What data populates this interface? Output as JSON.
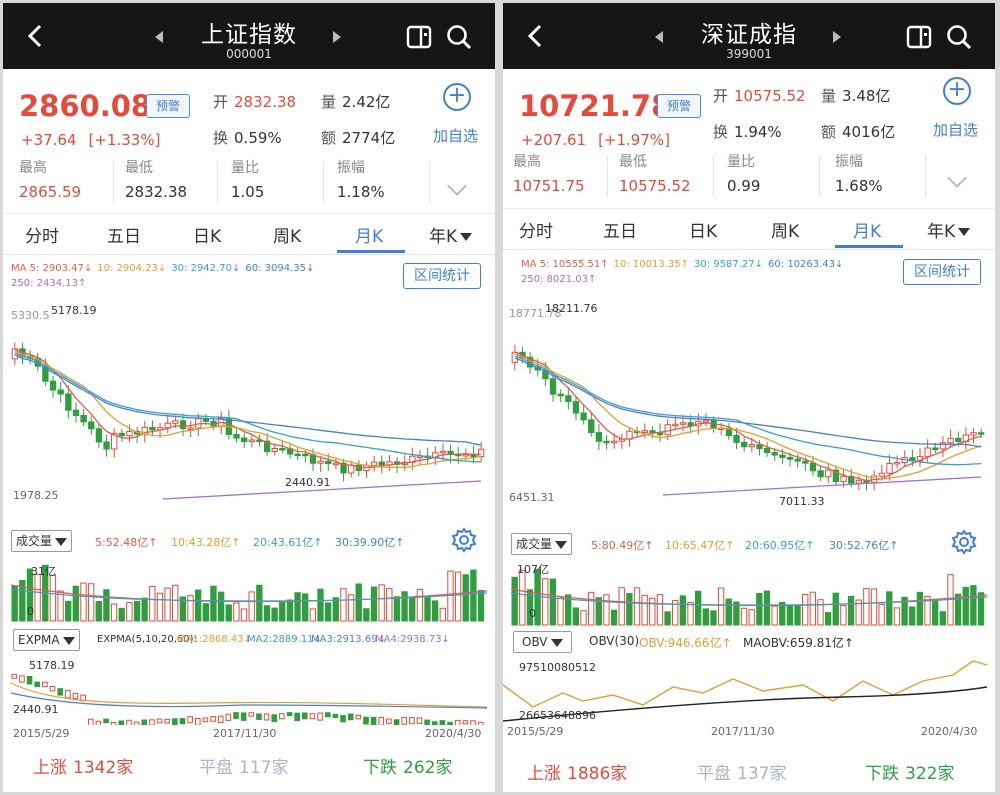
{
  "left": {
    "title": "上证指数",
    "code": "000001",
    "price": "2860.08",
    "warn_label": "预警",
    "change": "+37.64",
    "change_pct": "[+1.33%]",
    "open_label": "开",
    "open": "2832.38",
    "volume_label": "量",
    "volume": "2.42亿",
    "turnover_label": "换",
    "turnover": "0.59%",
    "amount_label": "额",
    "amount": "2774亿",
    "add_watch": "加自选",
    "high_label": "最高",
    "high": "2865.59",
    "low_label": "最低",
    "low": "2832.38",
    "ratio_label": "量比",
    "ratio": "1.05",
    "amp_label": "振幅",
    "amp": "1.18%",
    "tabs": [
      "分时",
      "五日",
      "日K",
      "周K",
      "月K",
      "年K"
    ],
    "active_tab": "月K",
    "ma": {
      "ma5": "MA 5: 2903.47↓",
      "ma10": "10: 2904.23↓",
      "ma30": "30: 2942.70↓",
      "ma60": "60: 3094.35↓",
      "ma250": "250: 2434.13↑"
    },
    "range_btn": "区间统计",
    "chart_top_label": "5330.5",
    "chart_max": "5178.19",
    "chart_min": "2440.91",
    "chart_bottom": "1978.25",
    "vol_dd": "成交量",
    "vol_ma": {
      "m5": "5:52.48亿↑",
      "m10": "10:43.28亿↑",
      "m20": "20:43.61亿↑",
      "m30": "30:39.90亿↑"
    },
    "vol_scale": "31亿",
    "vol_zero": "0",
    "ind_dd": "EXPMA",
    "ind_vals": {
      "p": "EXPMA(5,10,20,60):",
      "a": "MA1:2868.43↓",
      "b": "MA2:2889.11↓",
      "c": "MA3:2913.69↓",
      "d": "MA4:2938.73↓"
    },
    "ind_top": "5178.19",
    "ind_bottom": "2440.91",
    "dates": [
      "2015/5/29",
      "2017/11/30",
      "2020/4/30"
    ],
    "up_label": "上涨",
    "up": "1342家",
    "flat_label": "平盘",
    "flat": "117家",
    "down_label": "下跌",
    "down": "262家"
  },
  "right": {
    "title": "深证成指",
    "code": "399001",
    "price": "10721.78",
    "warn_label": "预警",
    "change": "+207.61",
    "change_pct": "[+1.97%]",
    "open_label": "开",
    "open": "10575.52",
    "volume_label": "量",
    "volume": "3.48亿",
    "turnover_label": "换",
    "turnover": "1.94%",
    "amount_label": "额",
    "amount": "4016亿",
    "add_watch": "加自选",
    "high_label": "最高",
    "high": "10751.75",
    "low_label": "最低",
    "low": "10575.52",
    "ratio_label": "量比",
    "ratio": "0.99",
    "amp_label": "振幅",
    "amp": "1.68%",
    "tabs": [
      "分时",
      "五日",
      "日K",
      "周K",
      "月K",
      "年K"
    ],
    "active_tab": "月K",
    "ma": {
      "ma5": "MA 5: 10555.51↑",
      "ma10": "10: 10013.35↑",
      "ma30": "30: 9587.27↓",
      "ma60": "60: 10263.43↓",
      "ma250": "250: 8021.03↑"
    },
    "range_btn": "区间统计",
    "chart_top_label": "18771.78",
    "chart_max": "18211.76",
    "chart_min": "7011.33",
    "chart_bottom": "6451.31",
    "vol_dd": "成交量",
    "vol_ma": {
      "m5": "5:80.49亿↑",
      "m10": "10:65.47亿↑",
      "m20": "20:60.95亿↑",
      "m30": "30:52.76亿↑"
    },
    "vol_scale": "107亿",
    "vol_zero": "0",
    "ind_dd": "OBV",
    "ind_vals": {
      "p": "OBV(30)",
      "a": "OBV:946.66亿↑",
      "b": "MAOBV:659.81亿↑"
    },
    "ind_top": "97510080512",
    "ind_bottom": "26653648896",
    "dates": [
      "2015/5/29",
      "2017/11/30",
      "2020/4/30"
    ],
    "up_label": "上涨",
    "up": "1886家",
    "flat_label": "平盘",
    "flat": "137家",
    "down_label": "下跌",
    "down": "322家"
  },
  "colors": {
    "up": "#e64a3a",
    "down": "#2e9e3f",
    "accent": "#3f7fd8",
    "ma5": "#e05d4f",
    "ma10": "#e0a030",
    "ma30": "#3aa0c8",
    "ma60": "#4a7fd0",
    "ma250": "#a070d8"
  }
}
